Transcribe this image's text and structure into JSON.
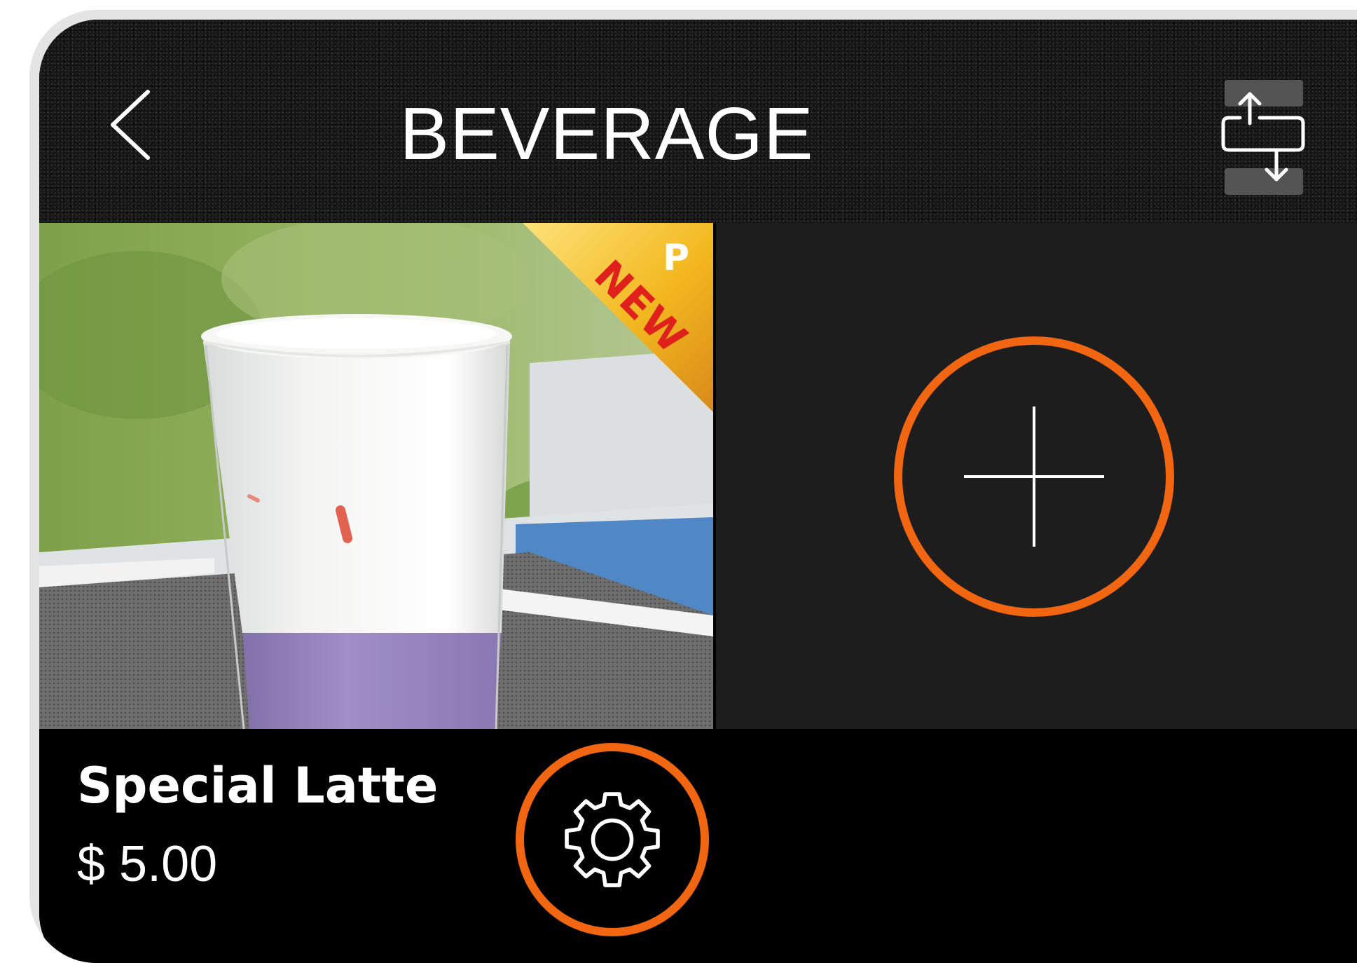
{
  "header": {
    "title": "BEVERAGE",
    "back_icon": "chevron-left-icon",
    "swap_icon": "reorder-swap-icon"
  },
  "menu": {
    "items": [
      {
        "name": "Special Latte",
        "price": "$ 5.00",
        "badge": "NEW",
        "badge_mark": "P",
        "settings_icon": "gear-icon"
      }
    ],
    "add_icon": "plus-icon"
  },
  "colors": {
    "accent": "#f26511",
    "header_bg": "#141414",
    "empty_tile": "#1d1d1d",
    "badge_gold": "#f3b81f",
    "badge_text": "#e0211b"
  }
}
